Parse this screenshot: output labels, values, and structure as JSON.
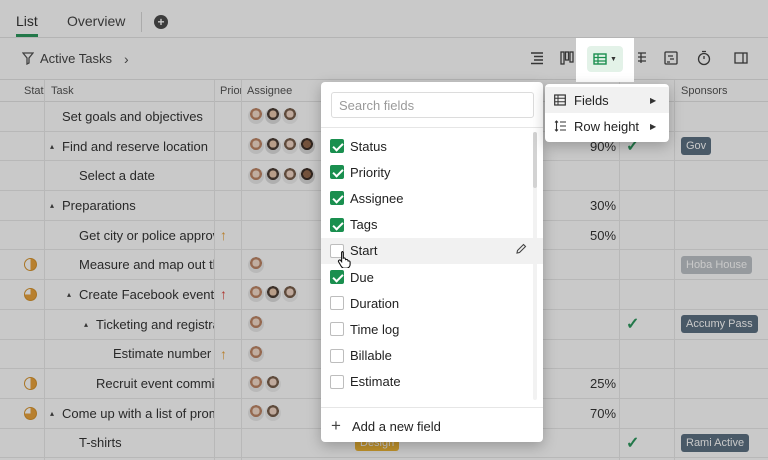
{
  "tabs": [
    {
      "label": "List"
    },
    {
      "label": "Overview"
    }
  ],
  "add_tab": "+",
  "toolbar": {
    "filter_label": "Active Tasks",
    "chevron": "›"
  },
  "table": {
    "headers": {
      "status": "Stat",
      "task": "Task",
      "priority": "Priori",
      "assignee": "Assignee",
      "sponsors": "Sponsors"
    },
    "rows": [
      {
        "task": "Set goals and objectives",
        "indent": 0,
        "caret": "",
        "status": "",
        "priority": "",
        "avatars": [
          "av1",
          "av2",
          "av3"
        ],
        "pct": "",
        "check": "",
        "sponsor": "",
        "tag": ""
      },
      {
        "task": "Find and reserve location",
        "indent": 0,
        "caret": "▴",
        "status": "",
        "priority": "",
        "avatars": [
          "av1",
          "av2",
          "av3",
          "av4"
        ],
        "pct": "90%",
        "check": "✓",
        "sponsor": "Gov",
        "tag": ""
      },
      {
        "task": "Select a date",
        "indent": 1,
        "caret": "",
        "status": "",
        "priority": "",
        "avatars": [
          "av1",
          "av2",
          "av3",
          "av4"
        ],
        "pct": "",
        "check": "",
        "sponsor": "",
        "tag": ""
      },
      {
        "task": "Preparations",
        "indent": 0,
        "caret": "▴",
        "status": "",
        "priority": "",
        "avatars": [],
        "pct": "30%",
        "check": "",
        "sponsor": "",
        "tag": ""
      },
      {
        "task": "Get city or police approv",
        "indent": 1,
        "caret": "",
        "status": "",
        "priority": "↑",
        "avatars": [],
        "pct": "50%",
        "check": "",
        "sponsor": "",
        "tag": ""
      },
      {
        "task": "Measure and map out th",
        "indent": 1,
        "caret": "",
        "status": "half",
        "priority": "",
        "avatars": [
          "av1"
        ],
        "pct": "",
        "check": "",
        "sponsor": "Hoba House",
        "tag": ""
      },
      {
        "task": "Create Facebook event",
        "indent": 1,
        "caret": "▴",
        "status": "quarter",
        "priority": "↑",
        "avatars": [
          "av1",
          "av2",
          "av3"
        ],
        "pct": "",
        "check": "",
        "sponsor": "",
        "tag": ""
      },
      {
        "task": "Ticketing and registra",
        "indent": 2,
        "caret": "▴",
        "status": "",
        "priority": "",
        "avatars": [
          "av1"
        ],
        "pct": "",
        "check": "✓",
        "sponsor": "Accumy Pass",
        "tag": ""
      },
      {
        "task": "Estimate number c",
        "indent": 3,
        "caret": "",
        "status": "",
        "priority": "↑",
        "avatars": [
          "av1"
        ],
        "pct": "",
        "check": "",
        "sponsor": "",
        "tag": ""
      },
      {
        "task": "Recruit event commit",
        "indent": 2,
        "caret": "",
        "status": "half",
        "priority": "",
        "avatars": [
          "av1",
          "av3"
        ],
        "pct": "25%",
        "check": "",
        "sponsor": "",
        "tag": ""
      },
      {
        "task": "Come up with a list of prom",
        "indent": 0,
        "caret": "▴",
        "status": "quarter",
        "priority": "",
        "avatars": [
          "av1",
          "av3"
        ],
        "pct": "70%",
        "check": "",
        "sponsor": "",
        "tag": ""
      },
      {
        "task": "T-shirts",
        "indent": 1,
        "caret": "",
        "status": "",
        "priority": "",
        "avatars": [],
        "pct": "",
        "check": "✓",
        "sponsor": "Rami Active",
        "tag": "Design"
      }
    ]
  },
  "fields_dropdown": {
    "search_placeholder": "Search fields",
    "fields": [
      {
        "label": "Status",
        "checked": true
      },
      {
        "label": "Priority",
        "checked": true
      },
      {
        "label": "Assignee",
        "checked": true
      },
      {
        "label": "Tags",
        "checked": true
      },
      {
        "label": "Start",
        "checked": false
      },
      {
        "label": "Due",
        "checked": true
      },
      {
        "label": "Duration",
        "checked": false
      },
      {
        "label": "Time log",
        "checked": false
      },
      {
        "label": "Billable",
        "checked": false
      },
      {
        "label": "Estimate",
        "checked": false
      }
    ],
    "add_field_label": "Add a new field",
    "add_field_icon": "+"
  },
  "settings_menu": {
    "items": [
      {
        "label": "Fields",
        "icon": "table-icon"
      },
      {
        "label": "Row height",
        "icon": "row-height-icon"
      }
    ]
  },
  "colors": {
    "accent": "#1a8f4f",
    "accent_light": "#e3f2e8",
    "chip": "#4e6478",
    "tag_design": "#f2b224",
    "priority_high": "#d9342b",
    "priority_med": "#e89a2a"
  }
}
